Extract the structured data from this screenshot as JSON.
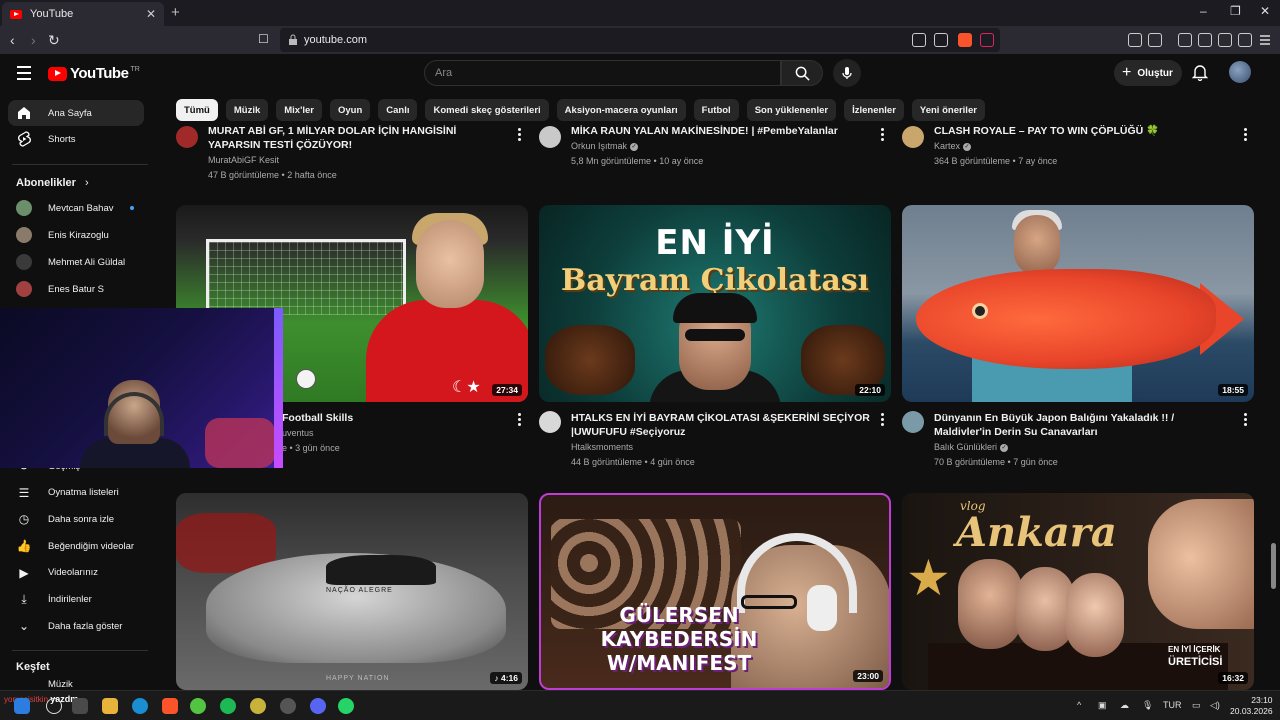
{
  "browser": {
    "tab_title": "YouTube",
    "url": "youtube.com"
  },
  "header": {
    "logo_text": "YouTube",
    "country_code": "TR",
    "search_placeholder": "Ara",
    "create_label": "Oluştur"
  },
  "chips": [
    "Tümü",
    "Müzik",
    "Mix'ler",
    "Oyun",
    "Canlı",
    "Komedi skeç gösterileri",
    "Aksiyon-macera oyunları",
    "Futbol",
    "Son yüklenenler",
    "İzlenenler",
    "Yeni öneriler"
  ],
  "sidebar": {
    "home": "Ana Sayfa",
    "shorts": "Shorts",
    "subscriptions_heading": "Abonelikler",
    "subscriptions": [
      {
        "name": "Mevtcan Bahav",
        "color": "#6b8f6a",
        "live": true
      },
      {
        "name": "Enis Kirazoglu",
        "color": "#8a7a6a",
        "live": false
      },
      {
        "name": "Mehmet Ali Güldal",
        "color": "#3a3a3a",
        "live": false
      },
      {
        "name": "Enes Batur S",
        "color": "#a04040",
        "live": false
      }
    ],
    "you_items": [
      "Geçmiş",
      "Oynatma listeleri",
      "Daha sonra izle",
      "Beğendiğim videolar",
      "Videolarınız",
      "İndirilenler",
      "Daha fazla göster"
    ],
    "explore_heading": "Keşfet",
    "explore_partial": "Müzik"
  },
  "videos_top_row": [
    {
      "title": "MURAT ABİ GF, 1 MİLYAR DOLAR İÇİN HANGİSİNİ YAPARSIN TESTİ ÇÖZÜYOR!",
      "channel": "MuratAbiGF Kesit",
      "verified": false,
      "meta": "47 B görüntüleme • 2 hafta önce",
      "avatar_color": "#a02a2a"
    },
    {
      "title": "MİKA RAUN YALAN MAKİNESİNDE! | #PembeYalanlar",
      "channel": "Orkun Işıtmak",
      "verified": true,
      "meta": "5,8 Mn görüntüleme • 10 ay önce",
      "avatar_color": "#c9c9c9"
    },
    {
      "title": "CLASH ROYALE – PAY TO WIN ÇÖPLÜĞÜ 🍀",
      "channel": "Kartex",
      "verified": true,
      "meta": "364 B görüntüleme • 7 ay önce",
      "avatar_color": "#c9a66b"
    }
  ],
  "videos_mid_row": [
    {
      "title_partial": "Football Skills",
      "channel_partial": "uventus",
      "meta_partial": "e • 3 gün önce",
      "duration": "27:34"
    },
    {
      "title": "HTALKS EN İYİ BAYRAM ÇİKOLATASI &ŞEKERİNİ SEÇİYOR |UWUFUFU #Seçiyoruz",
      "channel": "Htalksmoments",
      "verified": false,
      "meta": "44 B görüntüleme • 4 gün önce",
      "duration": "22:10",
      "avatar_color": "#d8d8d8",
      "thumb_line1": "EN İYİ",
      "thumb_line2": "Bayram Çikolatası"
    },
    {
      "title": "Dünyanın En Büyük Japon Balığını Yakaladık !! / Maldivler'in Derin Su Canavarları",
      "channel": "Balık Günlükleri",
      "verified": true,
      "meta": "70 B görüntüleme • 7 gün önce",
      "duration": "18:55",
      "avatar_color": "#7a9aa8"
    }
  ],
  "videos_bottom_row": [
    {
      "duration": "4:16",
      "watermark": "NAÇÃO ALEGRE",
      "watermark2": "HAPPY NATION"
    },
    {
      "duration": "23:00",
      "thumb_text": "GÜLERSEN KAYBEDERSİN W/MANIFEST"
    },
    {
      "duration": "16:32",
      "thumb_vlog": "vlog",
      "thumb_title": "Ankara",
      "thumb_badge1": "EN İYİ İÇERİK",
      "thumb_badge2": "ÜRETİCİSİ"
    }
  ],
  "taskbar": {
    "notif_user": "yoruseisitkin",
    "notif_action": "yazdm",
    "language": "TUR",
    "time": "23:10",
    "date": "20.03.2026"
  }
}
